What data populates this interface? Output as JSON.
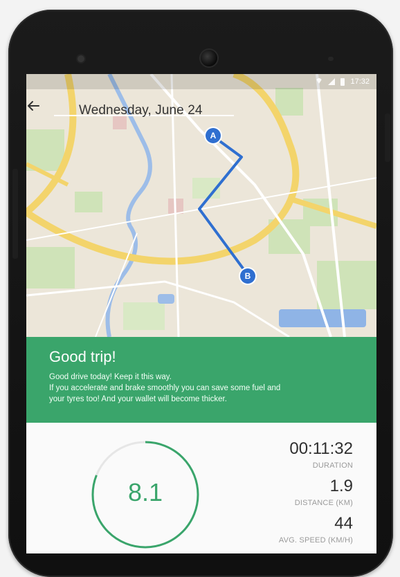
{
  "statusbar": {
    "time": "17:32"
  },
  "appbar": {
    "title": "Wednesday, June 24"
  },
  "map": {
    "start_label": "A",
    "end_label": "B",
    "route_color": "#2f6fd0"
  },
  "banner": {
    "title": "Good trip!",
    "line1": "Good drive today! Keep it this way.",
    "line2": "If you accelerate and brake smoothly you can save some fuel and",
    "line3": "your tyres too! And your wallet will become thicker.",
    "color": "#3aa56b"
  },
  "score": {
    "value": "8.1",
    "progress": 0.81
  },
  "stats": {
    "duration": {
      "value": "00:11:32",
      "label": "DURATION"
    },
    "distance": {
      "value": "1.9",
      "label": "DISTANCE (KM)"
    },
    "speed": {
      "value": "44",
      "label": "AVG. SPEED (KM/H)"
    }
  }
}
